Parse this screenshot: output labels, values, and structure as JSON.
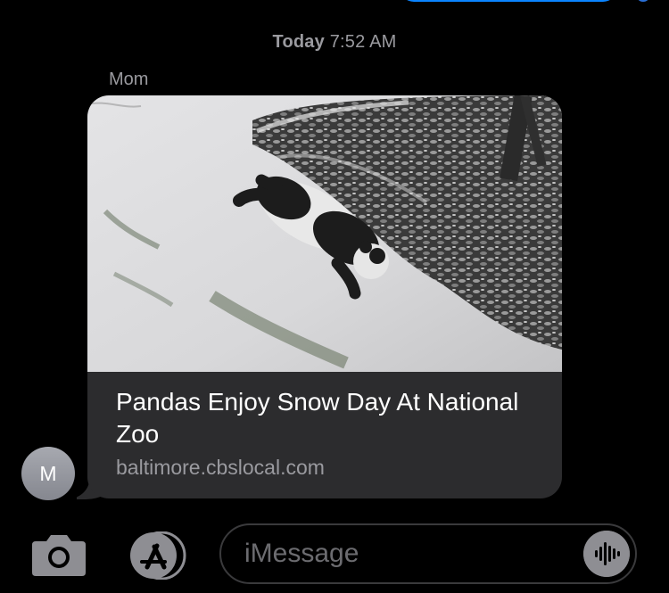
{
  "conversation": {
    "timestamp_day": "Today",
    "timestamp_time": "7:52 AM",
    "sender_name": "Mom",
    "avatar_initial": "M"
  },
  "link_preview": {
    "title": "Pandas Enjoy Snow Day At National Zoo",
    "domain": "baltimore.cbslocal.com",
    "image": "panda-rolling-in-snow"
  },
  "compose_bar": {
    "placeholder": "iMessage",
    "camera_icon": "camera-icon",
    "apps_icon": "app-store-icon",
    "audio_icon": "audio-waveform-icon"
  },
  "colors": {
    "background": "#000000",
    "received_bubble": "#2c2c2e",
    "secondary_text": "#9a9a9f",
    "sent_bubble": "#0a84ff"
  }
}
